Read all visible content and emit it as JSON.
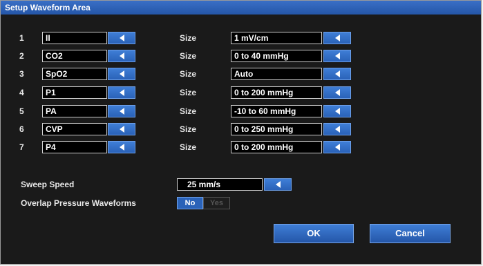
{
  "title": "Setup Waveform Area",
  "size_label": "Size",
  "rows": [
    {
      "num": "1",
      "wave": "II",
      "size": "1 mV/cm"
    },
    {
      "num": "2",
      "wave": "CO2",
      "size": "0 to 40 mmHg"
    },
    {
      "num": "3",
      "wave": "SpO2",
      "size": "Auto"
    },
    {
      "num": "4",
      "wave": "P1",
      "size": "0 to 200 mmHg"
    },
    {
      "num": "5",
      "wave": "PA",
      "size": "-10 to 60 mmHg"
    },
    {
      "num": "6",
      "wave": "CVP",
      "size": "0 to 250 mmHg"
    },
    {
      "num": "7",
      "wave": "P4",
      "size": "0 to 200 mmHg"
    }
  ],
  "sweep": {
    "label": "Sweep Speed",
    "value": "25 mm/s"
  },
  "overlap": {
    "label": "Overlap Pressure Waveforms",
    "no": "No",
    "yes": "Yes",
    "selected": "No"
  },
  "buttons": {
    "ok": "OK",
    "cancel": "Cancel"
  },
  "colors": {
    "accent": "#2a62b8",
    "background": "#1a1a1a"
  }
}
